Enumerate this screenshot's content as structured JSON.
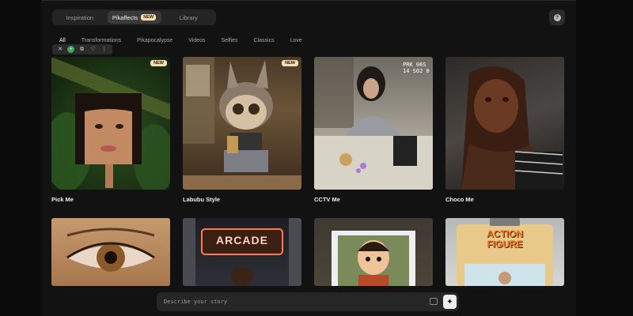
{
  "header": {
    "tabs": [
      {
        "label": "Inspiration"
      },
      {
        "label": "Pikaffects",
        "badge": "NEW"
      },
      {
        "label": "Library"
      }
    ],
    "help_icon": "question-icon"
  },
  "filters": [
    "All",
    "Transformations",
    "Pikapocalypse",
    "Videos",
    "Selfies",
    "Classics",
    "Love"
  ],
  "mini_toolbar": [
    "close-icon",
    "add-icon",
    "copy-icon",
    "bulb-icon",
    "more-icon"
  ],
  "cards": [
    {
      "title": "Pick Me",
      "badge": "NEW"
    },
    {
      "title": "Labubu Style",
      "badge": "NEW"
    },
    {
      "title": "CCTV Me",
      "overlay": "PRK 06S\n14 S02 0"
    },
    {
      "title": "Choco Me"
    },
    {
      "title": ""
    },
    {
      "title": "",
      "overlay": "ARCADE"
    },
    {
      "title": ""
    },
    {
      "title": "",
      "overlay": "ACTION\nFIGURE"
    }
  ],
  "prompt": {
    "placeholder": "Describe your story"
  },
  "colors": {
    "badge_bg": "#f3ddb5",
    "panel_bg": "#121212",
    "accent_green": "#3fa55b"
  }
}
